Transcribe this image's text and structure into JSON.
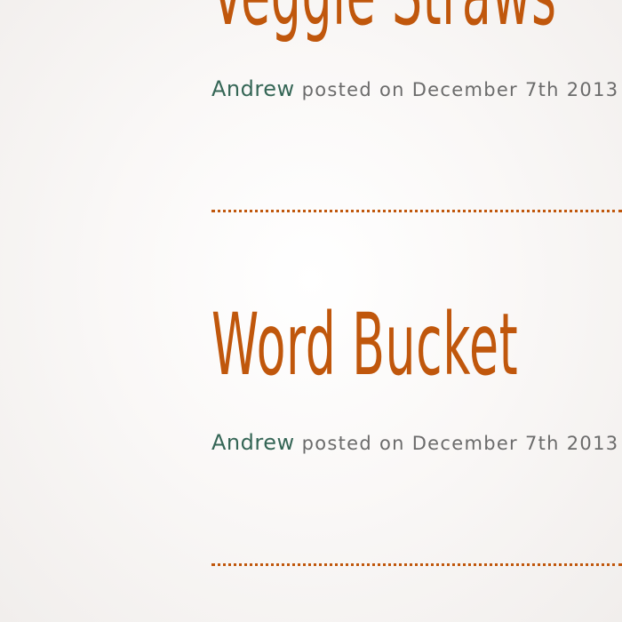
{
  "posts": [
    {
      "title": "Veggie Straws",
      "author": "Andrew",
      "meta": " posted on December 7th 2013"
    },
    {
      "title": "Word Bucket",
      "author": "Andrew",
      "meta": " posted on December 7th 2013"
    }
  ],
  "colors": {
    "title": "#c0570c",
    "author": "#356656",
    "meta": "#6b6b6b",
    "divider": "#c0570c"
  }
}
